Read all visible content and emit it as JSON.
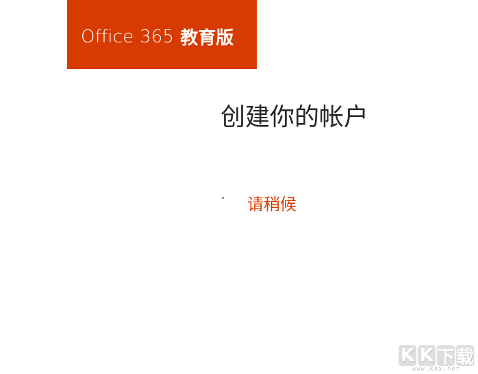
{
  "brand": {
    "product_name": "Office 365",
    "edition": "教育版",
    "color": "#d83b01"
  },
  "page": {
    "title": "创建你的帐户",
    "status": "请稍候",
    "status_color": "#d83b01"
  },
  "watermark": {
    "logo_chars": [
      "K",
      "K",
      "下",
      "载"
    ],
    "url": "www.kkx.net"
  }
}
